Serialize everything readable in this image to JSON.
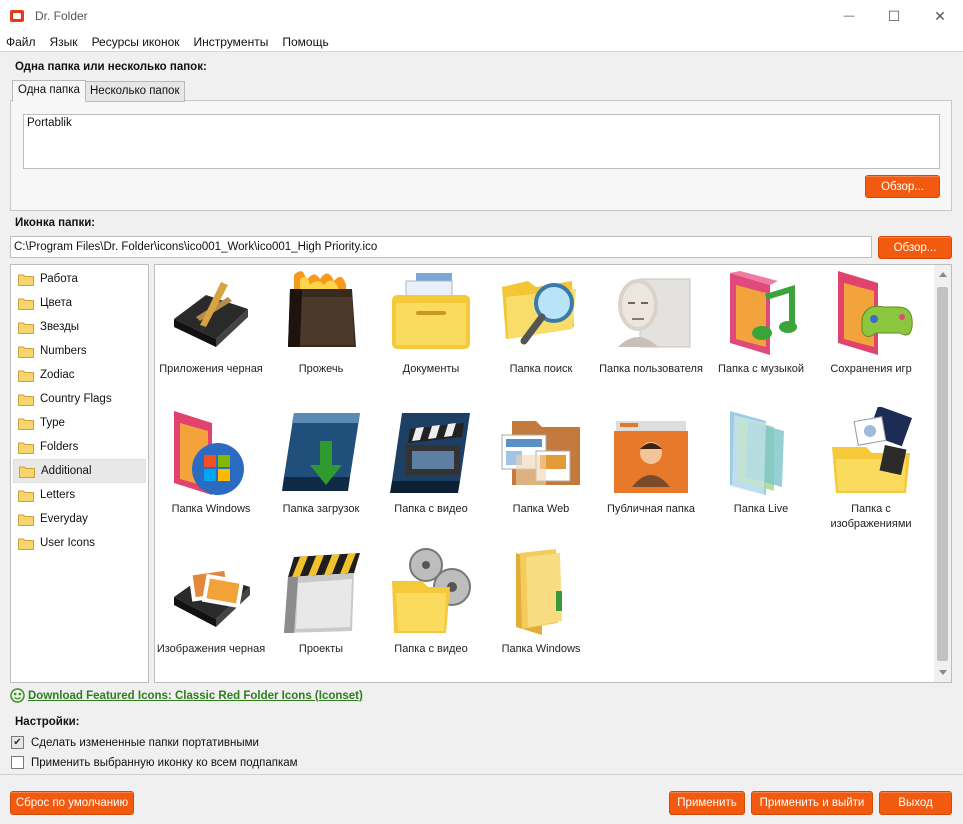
{
  "window": {
    "title": "Dr. Folder"
  },
  "window_controls": {
    "minimize": "—",
    "maximize": "☐",
    "close": "✕"
  },
  "menu": [
    "Файл",
    "Язык",
    "Ресурсы иконок",
    "Инструменты",
    "Помощь"
  ],
  "folders_section": {
    "label": "Одна папка или несколько папок:",
    "tabs": [
      "Одна папка",
      "Несколько папок"
    ],
    "active_tab": 0,
    "folder_text": "Portablik",
    "browse_button": "Обзор..."
  },
  "icon_section": {
    "label": "Иконка папки:",
    "path": "C:\\Program Files\\Dr. Folder\\icons\\ico001_Work\\ico001_High Priority.ico",
    "browse_button": "Обзор..."
  },
  "categories": [
    "Работа",
    "Цвета",
    "Звезды",
    "Numbers",
    "Zodiac",
    "Country Flags",
    "Type",
    "Folders",
    "Additional",
    "Letters",
    "Everyday",
    "User Icons"
  ],
  "selected_category": "Additional",
  "icons": [
    "Приложения черная",
    "Прожечь",
    "Документы",
    "Папка поиск",
    "Папка пользователя",
    "Папка с музыкой",
    "Сохранения игр",
    "Папка Windows",
    "Папка загрузок",
    "Папка с видео",
    "Папка Web",
    "Публичная папка",
    "Папка Live",
    "Папка с изображениями",
    "Изображения черная",
    "Проекты",
    "Папка с видео",
    "Папка Windows"
  ],
  "featured_link": "Download Featured Icons: Classic Red Folder Icons (Iconset)",
  "settings": {
    "label": "Настройки:",
    "portable": {
      "label": "Сделать измененные папки портативными",
      "checked": true
    },
    "apply_subfolders": {
      "label": "Применить выбранную иконку ко всем подпапкам",
      "checked": false
    }
  },
  "buttons": {
    "reset": "Сброс по умолчанию",
    "apply": "Применить",
    "apply_exit": "Применить и выйти",
    "exit": "Выход"
  },
  "colors": {
    "accent": "#f25a0f",
    "link": "#2e7d1f"
  }
}
